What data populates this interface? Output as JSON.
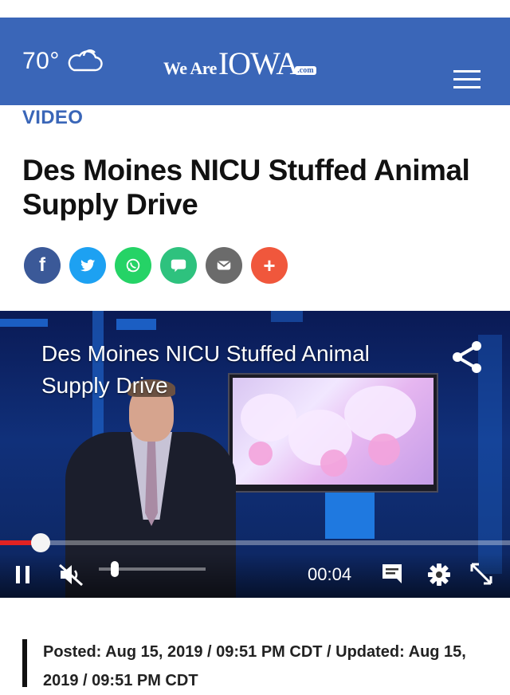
{
  "header": {
    "weather": {
      "temperature": "70°",
      "icon": "cloud-icon"
    },
    "logo": {
      "prefix": "We Are",
      "name": "IOWA",
      "suffix": ".com"
    },
    "menu_icon": "hamburger-menu-icon",
    "background_color": "#3a66b8"
  },
  "article": {
    "category": "VIDEO",
    "title": "Des Moines NICU Stuffed Animal Supply Drive",
    "share_buttons": [
      {
        "network": "facebook",
        "icon": "f",
        "color": "#3b5998"
      },
      {
        "network": "twitter",
        "icon": "twitter-bird-icon",
        "color": "#1da1f2"
      },
      {
        "network": "whatsapp",
        "icon": "whatsapp-icon",
        "color": "#25d366"
      },
      {
        "network": "sms",
        "icon": "SMS",
        "color": "#2ec27e"
      },
      {
        "network": "email",
        "icon": "envelope-icon",
        "color": "#6b6b6b"
      },
      {
        "network": "more",
        "icon": "+",
        "color": "#f0573c"
      }
    ],
    "posted": "Posted: Aug 15, 2019 / 09:51 PM CDT / Updated: Aug 15, 2019 / 09:51 PM CDT"
  },
  "video": {
    "title": "Des Moines NICU Stuffed Animal Supply Drive",
    "current_time": "00:04",
    "playback_progress_fraction": 0.08,
    "volume_fraction": 0.15,
    "state": "playing",
    "muted": true,
    "progress_color": "#e22222"
  }
}
